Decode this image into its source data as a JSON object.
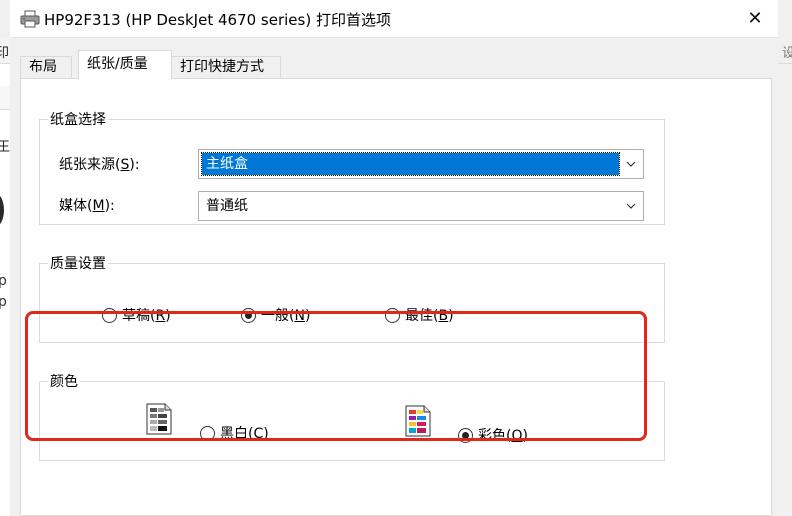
{
  "background": {
    "left_text_1": "印",
    "left_text_2": "王",
    "left_text_3": "p",
    "left_text_4": "p",
    "right_text": "设"
  },
  "window": {
    "title": "HP92F313 (HP DeskJet 4670 series) 打印首选项",
    "close_glyph": "✕"
  },
  "tabs": [
    {
      "label": "布局"
    },
    {
      "label": "纸张/质量"
    },
    {
      "label": "打印快捷方式"
    }
  ],
  "tray": {
    "legend": "纸盒选择",
    "source_label_pre": "纸张来源(",
    "source_label_key": "S",
    "source_label_post": "):",
    "source_value": "主纸盒",
    "media_label_pre": "媒体(",
    "media_label_key": "M",
    "media_label_post": "):",
    "media_value": "普通纸"
  },
  "quality": {
    "legend": "质量设置",
    "options": [
      {
        "pre": "草稿(",
        "key": "R",
        "post": ")",
        "selected": false
      },
      {
        "pre": "一般(",
        "key": "N",
        "post": ")",
        "selected": true
      },
      {
        "pre": "最佳(",
        "key": "B",
        "post": ")",
        "selected": false
      }
    ]
  },
  "color": {
    "legend": "颜色",
    "options": [
      {
        "pre": "黑白(",
        "key": "C",
        "post": ")",
        "selected": false,
        "icon": "grayscale-page-icon"
      },
      {
        "pre": "彩色(",
        "key": "O",
        "post": ")",
        "selected": true,
        "icon": "color-page-icon"
      }
    ]
  },
  "colors": {
    "selection_blue": "#0078d7",
    "annotation_red": "#e1261c"
  }
}
